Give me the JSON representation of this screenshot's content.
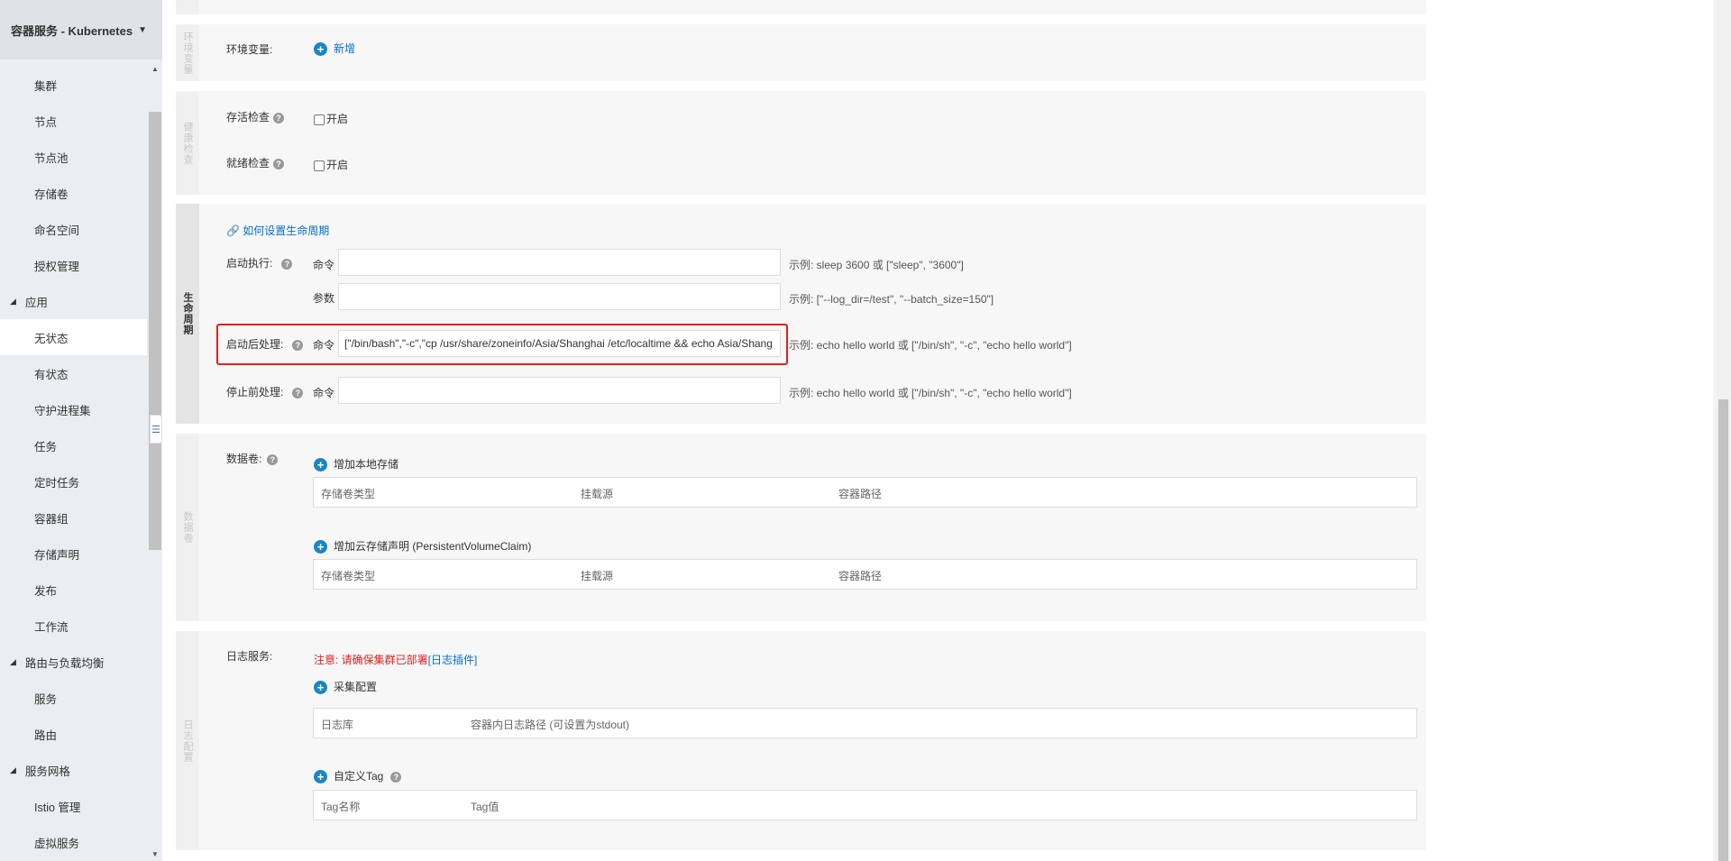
{
  "sidebar": {
    "title": "容器服务 - Kubernetes",
    "items": [
      {
        "type": "item",
        "label": "集群"
      },
      {
        "type": "item",
        "label": "节点"
      },
      {
        "type": "item",
        "label": "节点池"
      },
      {
        "type": "item",
        "label": "存储卷"
      },
      {
        "type": "item",
        "label": "命名空间"
      },
      {
        "type": "item",
        "label": "授权管理"
      },
      {
        "type": "group",
        "label": "应用"
      },
      {
        "type": "item",
        "label": "无状态",
        "active": true
      },
      {
        "type": "item",
        "label": "有状态"
      },
      {
        "type": "item",
        "label": "守护进程集"
      },
      {
        "type": "item",
        "label": "任务"
      },
      {
        "type": "item",
        "label": "定时任务"
      },
      {
        "type": "item",
        "label": "容器组"
      },
      {
        "type": "item",
        "label": "存储声明"
      },
      {
        "type": "item",
        "label": "发布"
      },
      {
        "type": "item",
        "label": "工作流"
      },
      {
        "type": "group",
        "label": "路由与负载均衡"
      },
      {
        "type": "item",
        "label": "服务"
      },
      {
        "type": "item",
        "label": "路由"
      },
      {
        "type": "group",
        "label": "服务网格"
      },
      {
        "type": "item",
        "label": "Istio 管理"
      },
      {
        "type": "item",
        "label": "虚拟服务"
      }
    ]
  },
  "env": {
    "tab": "环境变量",
    "label": "环境变量:",
    "add_label": "新增"
  },
  "health": {
    "tab": "健康检查",
    "liveness_label": "存活检查",
    "readiness_label": "就绪检查",
    "enable_label": "开启"
  },
  "lifecycle": {
    "tab": "生命周期",
    "help_link": "如何设置生命周期",
    "start_label": "启动执行:",
    "command_label": "命令",
    "args_label": "参数",
    "start_hint": "示例: sleep 3600 或 [\"sleep\", \"3600\"]",
    "args_hint": "示例: [\"--log_dir=/test\", \"--batch_size=150\"]",
    "poststart_label": "启动后处理:",
    "poststart_value": "[\"/bin/bash\",\"-c\",\"cp /usr/share/zoneinfo/Asia/Shanghai /etc/localtime && echo Asia/Shang",
    "poststart_hint": "示例: echo hello world 或 [\"/bin/sh\", \"-c\", \"echo hello world\"]",
    "prestop_label": "停止前处理:",
    "prestop_hint": "示例: echo hello world 或 [\"/bin/sh\", \"-c\", \"echo hello world\"]"
  },
  "volumes": {
    "tab": "数据卷",
    "label": "数据卷:",
    "add_local": "增加本地存储",
    "add_pvc": "增加云存储声明 (PersistentVolumeClaim)",
    "col_type": "存储卷类型",
    "col_source": "挂载源",
    "col_path": "容器路径"
  },
  "logs": {
    "tab": "日志配置",
    "label": "日志服务:",
    "notice": "注意: 请确保集群已部署",
    "notice_link": "[日志插件]",
    "collect": "采集配置",
    "col_logstore": "日志库",
    "col_logpath": "容器内日志路径 (可设置为stdout)",
    "custom_tag": "自定义Tag",
    "col_tagname": "Tag名称",
    "col_tagvalue": "Tag值"
  },
  "icons": {
    "help": "?",
    "plus": "+",
    "link": "🔗",
    "caret": "▼",
    "tri": "◢",
    "menu_toggle": "☰",
    "scroll_up": "▲",
    "scroll_down": "▼"
  },
  "colors": {
    "link": "#0070cc",
    "highlight": "#e02020",
    "plus": "#1a85c8"
  }
}
